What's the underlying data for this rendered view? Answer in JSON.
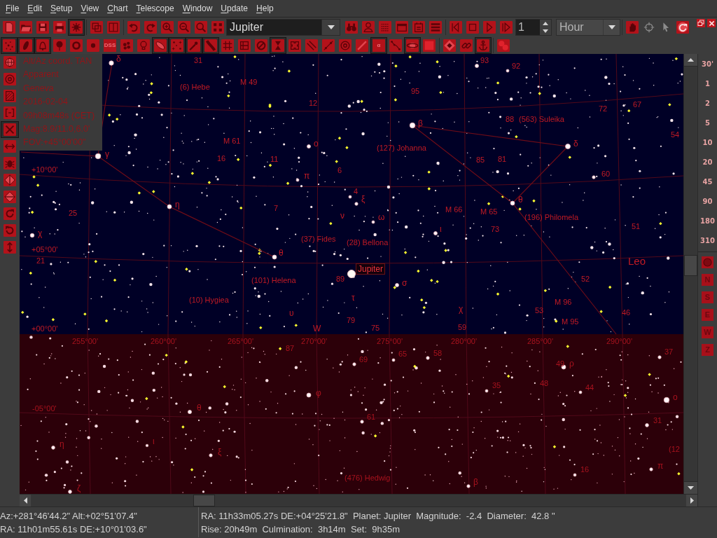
{
  "menu_bar": [
    "File",
    "Edit",
    "Setup",
    "View",
    "Chart",
    "Telescope",
    "Window",
    "Update",
    "Help"
  ],
  "main_toolbar": [
    {
      "kind": "button",
      "pressed": false,
      "disabled": false
    },
    {
      "kind": "button",
      "pressed": false,
      "disabled": false
    },
    {
      "kind": "button",
      "pressed": false,
      "disabled": false
    },
    {
      "kind": "button",
      "pressed": false,
      "disabled": false
    },
    {
      "kind": "button",
      "pressed": true,
      "disabled": false
    },
    {
      "kind": "separator"
    },
    {
      "kind": "button",
      "pressed": false,
      "disabled": false
    },
    {
      "kind": "button",
      "pressed": false,
      "disabled": false
    },
    {
      "kind": "separator"
    },
    {
      "kind": "button",
      "pressed": false,
      "disabled": false
    },
    {
      "kind": "button",
      "pressed": false,
      "disabled": false
    },
    {
      "kind": "button",
      "pressed": false,
      "disabled": false
    },
    {
      "kind": "button",
      "pressed": false,
      "disabled": false
    },
    {
      "kind": "button",
      "pressed": false,
      "disabled": false
    },
    {
      "kind": "button",
      "pressed": false,
      "disabled": false
    },
    {
      "kind": "combo",
      "value": "Jupiter"
    },
    {
      "kind": "button",
      "pressed": false,
      "disabled": false
    },
    {
      "kind": "button",
      "pressed": false,
      "disabled": false
    },
    {
      "kind": "button",
      "pressed": false,
      "disabled": false
    },
    {
      "kind": "button",
      "pressed": false,
      "disabled": false
    },
    {
      "kind": "button",
      "pressed": false,
      "disabled": false
    },
    {
      "kind": "button",
      "pressed": false,
      "disabled": false
    },
    {
      "kind": "separator"
    },
    {
      "kind": "button",
      "pressed": false,
      "disabled": false
    },
    {
      "kind": "button",
      "pressed": false,
      "disabled": false
    },
    {
      "kind": "button",
      "pressed": false,
      "disabled": false
    },
    {
      "kind": "button",
      "pressed": false,
      "disabled": false
    },
    {
      "kind": "spin",
      "value": "1"
    },
    {
      "kind": "dropdown",
      "value": "Hour"
    },
    {
      "kind": "separator"
    },
    {
      "kind": "button",
      "pressed": false,
      "disabled": false
    },
    {
      "kind": "button",
      "pressed": false,
      "disabled": true
    },
    {
      "kind": "button",
      "pressed": false,
      "disabled": true
    },
    {
      "kind": "button",
      "pressed": false,
      "disabled": false
    }
  ],
  "object_toolbar": [
    {
      "kind": "button",
      "pressed": true
    },
    {
      "kind": "button",
      "pressed": true
    },
    {
      "kind": "button",
      "pressed": true
    },
    {
      "kind": "button",
      "pressed": false
    },
    {
      "kind": "button",
      "pressed": false
    },
    {
      "kind": "button",
      "pressed": false
    },
    {
      "kind": "text_button",
      "label": "DSS",
      "pressed": false
    },
    {
      "kind": "button",
      "pressed": false
    },
    {
      "kind": "button",
      "pressed": false
    },
    {
      "kind": "button",
      "pressed": true
    },
    {
      "kind": "button",
      "pressed": true
    },
    {
      "kind": "button",
      "pressed": true
    },
    {
      "kind": "button",
      "pressed": true
    },
    {
      "kind": "button",
      "pressed": false
    },
    {
      "kind": "button",
      "pressed": false
    },
    {
      "kind": "button",
      "pressed": false
    },
    {
      "kind": "button",
      "pressed": true
    },
    {
      "kind": "button",
      "pressed": false
    },
    {
      "kind": "button",
      "pressed": false
    },
    {
      "kind": "button",
      "pressed": false
    },
    {
      "kind": "button",
      "pressed": false
    },
    {
      "kind": "button",
      "pressed": false
    },
    {
      "kind": "text_button",
      "label": "α",
      "pressed": true
    },
    {
      "kind": "button",
      "pressed": false
    },
    {
      "kind": "button",
      "pressed": true
    },
    {
      "kind": "button",
      "pressed": false
    },
    {
      "kind": "separator"
    },
    {
      "kind": "button",
      "pressed": false
    },
    {
      "kind": "button",
      "pressed": false
    },
    {
      "kind": "button",
      "pressed": true
    },
    {
      "kind": "separator"
    },
    {
      "kind": "button",
      "pressed": false
    }
  ],
  "chart_tools": [
    {
      "pressed": false
    },
    {
      "pressed": false
    },
    {
      "pressed": false
    },
    {
      "pressed": false
    },
    {
      "pressed": true
    },
    {
      "pressed": false
    },
    {
      "pressed": false
    },
    {
      "pressed": false
    },
    {
      "pressed": false
    },
    {
      "pressed": false
    },
    {
      "pressed": false
    },
    {
      "pressed": false
    }
  ],
  "chart_info": [
    "Alt/Az coord. TAN",
    "Apparent",
    "Geneva",
    "2016-02-04",
    "09h08m48s (CET)",
    "Mag:8.9/11.0,6.0'",
    "FOV:+45°00'00\""
  ],
  "chart_labels": [
    {
      "text": "δ",
      "kind": "greek"
    },
    {
      "text": "31",
      "kind": "number"
    },
    {
      "text": "93",
      "kind": "number"
    },
    {
      "text": "92",
      "kind": "number"
    },
    {
      "text": "(6) Hebe",
      "kind": "name"
    },
    {
      "text": "M 49",
      "kind": "name"
    },
    {
      "text": "95",
      "kind": "number"
    },
    {
      "text": "12",
      "kind": "number"
    },
    {
      "text": "72",
      "kind": "number"
    },
    {
      "text": "67",
      "kind": "number"
    },
    {
      "text": "β",
      "kind": "greek"
    },
    {
      "text": "88",
      "kind": "number"
    },
    {
      "text": "(563) Suleika",
      "kind": "name"
    },
    {
      "text": "M 61",
      "kind": "name"
    },
    {
      "text": "ο",
      "kind": "greek"
    },
    {
      "text": "(127) Johanna",
      "kind": "name"
    },
    {
      "text": "δ",
      "kind": "greek"
    },
    {
      "text": "54",
      "kind": "number"
    },
    {
      "text": "γ",
      "kind": "greek"
    },
    {
      "text": "16",
      "kind": "number"
    },
    {
      "text": "11",
      "kind": "number"
    },
    {
      "text": "85",
      "kind": "number"
    },
    {
      "text": "81",
      "kind": "number"
    },
    {
      "text": "+10°00'",
      "kind": "grid"
    },
    {
      "text": "π",
      "kind": "greek"
    },
    {
      "text": "6",
      "kind": "number"
    },
    {
      "text": "60",
      "kind": "number"
    },
    {
      "text": "4",
      "kind": "number"
    },
    {
      "text": "25",
      "kind": "number"
    },
    {
      "text": "η",
      "kind": "greek"
    },
    {
      "text": "7",
      "kind": "number"
    },
    {
      "text": "ν",
      "kind": "greek"
    },
    {
      "text": "ξ",
      "kind": "greek"
    },
    {
      "text": "ω",
      "kind": "greek"
    },
    {
      "text": "M 66",
      "kind": "name"
    },
    {
      "text": "M 65",
      "kind": "name"
    },
    {
      "text": "θ",
      "kind": "greek"
    },
    {
      "text": "(196) Philomela",
      "kind": "name"
    },
    {
      "text": "χ",
      "kind": "greek"
    },
    {
      "text": "ι",
      "kind": "greek"
    },
    {
      "text": "73",
      "kind": "number"
    },
    {
      "text": "51",
      "kind": "number"
    },
    {
      "text": "(37) Fides",
      "kind": "name"
    },
    {
      "text": "(28) Bellona",
      "kind": "name"
    },
    {
      "text": "+05°00'",
      "kind": "grid"
    },
    {
      "text": "θ",
      "kind": "greek"
    },
    {
      "text": "21",
      "kind": "number"
    },
    {
      "text": "Leo",
      "kind": "constellation"
    },
    {
      "text": "Jupiter",
      "kind": "selected"
    },
    {
      "text": "(101) Helena",
      "kind": "name"
    },
    {
      "text": "89",
      "kind": "number"
    },
    {
      "text": "σ",
      "kind": "greek"
    },
    {
      "text": "52",
      "kind": "number"
    },
    {
      "text": "(10) Hygiea",
      "kind": "name"
    },
    {
      "text": "τ",
      "kind": "greek"
    },
    {
      "text": "M 96",
      "kind": "name"
    },
    {
      "text": "υ",
      "kind": "greek"
    },
    {
      "text": "χ",
      "kind": "greek"
    },
    {
      "text": "53",
      "kind": "number"
    },
    {
      "text": "46",
      "kind": "number"
    },
    {
      "text": "79",
      "kind": "number"
    },
    {
      "text": "M 95",
      "kind": "name"
    },
    {
      "text": "+00°00'",
      "kind": "grid"
    },
    {
      "text": "W",
      "kind": "direction"
    },
    {
      "text": "75",
      "kind": "number"
    },
    {
      "text": "59",
      "kind": "number"
    },
    {
      "text": "255°00'",
      "kind": "grid"
    },
    {
      "text": "260°00'",
      "kind": "grid"
    },
    {
      "text": "265°00'",
      "kind": "grid"
    },
    {
      "text": "270°00'",
      "kind": "grid"
    },
    {
      "text": "275°00'",
      "kind": "grid"
    },
    {
      "text": "280°00'",
      "kind": "grid"
    },
    {
      "text": "285°00'",
      "kind": "grid"
    },
    {
      "text": "290°00'",
      "kind": "grid"
    },
    {
      "text": "87",
      "kind": "number"
    },
    {
      "text": "69",
      "kind": "number"
    },
    {
      "text": "65",
      "kind": "number"
    },
    {
      "text": "58",
      "kind": "number"
    },
    {
      "text": "37",
      "kind": "number"
    },
    {
      "text": "49",
      "kind": "number"
    },
    {
      "text": "ρ",
      "kind": "greek"
    },
    {
      "text": "φ",
      "kind": "greek"
    },
    {
      "text": "35",
      "kind": "number"
    },
    {
      "text": "48",
      "kind": "number"
    },
    {
      "text": "44",
      "kind": "number"
    },
    {
      "text": "ο",
      "kind": "greek"
    },
    {
      "text": "-05°00'",
      "kind": "grid"
    },
    {
      "text": "θ",
      "kind": "greek"
    },
    {
      "text": "61",
      "kind": "number"
    },
    {
      "text": "31",
      "kind": "number"
    },
    {
      "text": "η",
      "kind": "greek"
    },
    {
      "text": "ι",
      "kind": "greek"
    },
    {
      "text": "ξ",
      "kind": "greek"
    },
    {
      "text": "(12",
      "kind": "name"
    },
    {
      "text": "16",
      "kind": "number"
    },
    {
      "text": "π",
      "kind": "greek"
    },
    {
      "text": "ζ",
      "kind": "greek"
    },
    {
      "text": "(476) Hedwig",
      "kind": "name"
    },
    {
      "text": "β",
      "kind": "greek"
    }
  ],
  "fov_buttons": [
    "30'",
    "1",
    "2",
    "5",
    "10",
    "20",
    "45",
    "90",
    "180",
    "310"
  ],
  "orientation_buttons": [
    "N",
    "S",
    "E",
    "W",
    "Z"
  ],
  "status_bar": {
    "cursor": [
      "Az:+281°46'44.2\" Alt:+02°51'07.4\"",
      "RA: 11h01m55.61s DE:+10°01'03.6\""
    ],
    "object": [
      "RA: 11h33m05.27s DE:+04°25'21.8\"  Planet: Jupiter  Magnitude:  -2.4  Diameter:  42.8 \"",
      "Rise: 20h49m  Culmination:  3h14m  Set:  9h35m"
    ]
  }
}
